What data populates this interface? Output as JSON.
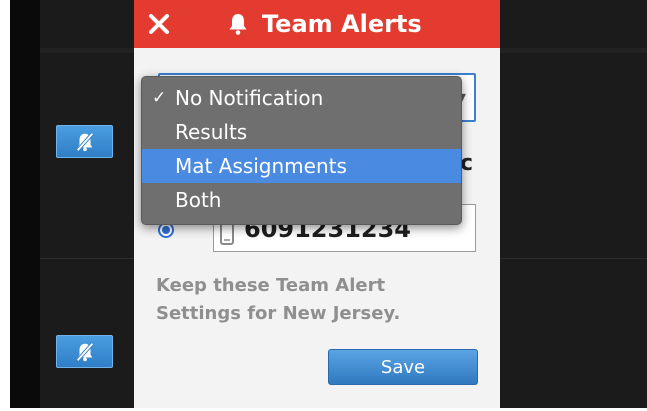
{
  "header": {
    "title": "Team Alerts"
  },
  "icons": {
    "close": "close-x-icon",
    "bell": "bell-icon",
    "mute": "bell-slash-icon",
    "phone": "phone-icon",
    "check": "checkmark-icon"
  },
  "dropdown": {
    "check_glyph": "✓",
    "options": [
      "No Notification",
      "Results",
      "Mat Assignments",
      "Both"
    ],
    "selected": "No Notification",
    "highlighted": "Mat Assignments"
  },
  "partial_label": "c",
  "phone": {
    "value": "6091231234"
  },
  "keep_settings": {
    "text": "Keep these Team Alert Settings for New Jersey."
  },
  "save": {
    "label": "Save"
  },
  "colors": {
    "header_red": "#e33b2f",
    "accent_blue": "#3b7fd0",
    "highlight_blue": "#4a8ae0",
    "menu_gray": "#6f6f6f"
  }
}
